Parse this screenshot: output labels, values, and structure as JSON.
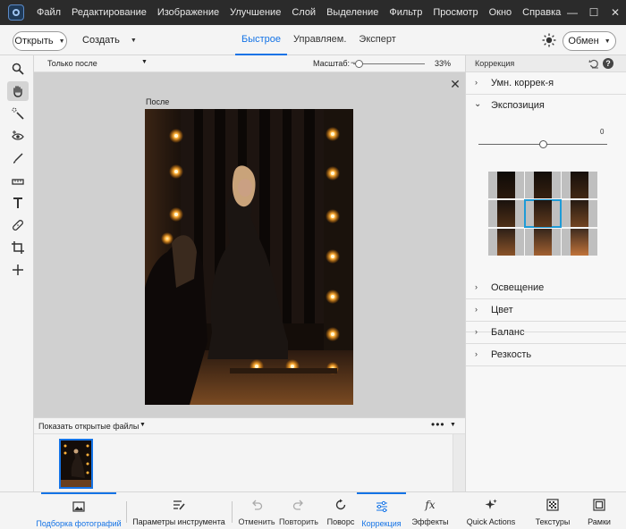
{
  "menu": [
    "Файл",
    "Редактирование",
    "Изображение",
    "Улучшение",
    "Слой",
    "Выделение",
    "Фильтр",
    "Просмотр",
    "Окно",
    "Справка"
  ],
  "window_controls": [
    "—",
    "☐",
    "✕"
  ],
  "toolbar": {
    "open_label": "Открыть",
    "create_label": "Создать",
    "modes": [
      "Быстрое",
      "Управляем.",
      "Эксперт"
    ],
    "active_mode": "Быстрое",
    "share_label": "Обмен"
  },
  "tools": [
    "zoom-tool",
    "hand-tool",
    "quick-selection-tool",
    "red-eye-tool",
    "whiten-teeth-tool",
    "straighten-tool",
    "text-tool",
    "spot-healing-tool",
    "crop-tool",
    "move-tool"
  ],
  "view": {
    "mode_select": "Только после",
    "zoom_label": "Масштаб:",
    "zoom_minus": "−",
    "zoom_value": "33%",
    "zoom_fraction": 0.08
  },
  "canvas": {
    "after_label": "После",
    "close": "✕"
  },
  "bin": {
    "select_label": "Показать открытые файлы",
    "more": "•••"
  },
  "panel": {
    "title": "Коррекция",
    "help": "?",
    "sections": [
      {
        "label": "Умн. коррек-я",
        "expanded": false
      },
      {
        "label": "Экспозиция",
        "expanded": true
      },
      {
        "label": "Освещение",
        "expanded": false
      },
      {
        "label": "Цвет",
        "expanded": false
      },
      {
        "label": "Баланс",
        "expanded": false
      },
      {
        "label": "Резкость",
        "expanded": false
      }
    ],
    "exposure": {
      "value": "0",
      "slider_fraction": 0.5,
      "grid_selected_index": 4,
      "brightness_levels": [
        0.35,
        0.45,
        0.55,
        0.65,
        0.8,
        0.95,
        1.15,
        1.35,
        1.6
      ]
    }
  },
  "bottom": {
    "items": [
      {
        "key": "photo_bin",
        "label": "Подборка фотографий",
        "icon": "photo-bin-icon",
        "active": true
      },
      {
        "key": "tool_options",
        "label": "Параметры инструмента",
        "icon": "tool-options-icon",
        "active": false
      },
      {
        "key": "undo",
        "label": "Отменить",
        "icon": "undo-icon",
        "disabled": true
      },
      {
        "key": "redo",
        "label": "Повторить",
        "icon": "redo-icon",
        "disabled": true
      },
      {
        "key": "rotate",
        "label": "Поворс",
        "icon": "rotate-icon",
        "active": false
      },
      {
        "key": "adjustments",
        "label": "Коррекция",
        "icon": "adjustments-icon",
        "active": true
      },
      {
        "key": "effects",
        "label": "Эффекты",
        "icon": "fx-icon",
        "active": false
      },
      {
        "key": "quick_actions",
        "label": "Quick Actions",
        "icon": "quick-actions-icon",
        "active": false
      },
      {
        "key": "textures",
        "label": "Текстуры",
        "icon": "textures-icon",
        "active": false
      },
      {
        "key": "frames",
        "label": "Рамки",
        "icon": "frames-icon",
        "active": false
      }
    ]
  },
  "colors": {
    "accent": "#1473e6",
    "menubar": "#2b2b2b",
    "canvas_bg": "#d0d0d0"
  }
}
